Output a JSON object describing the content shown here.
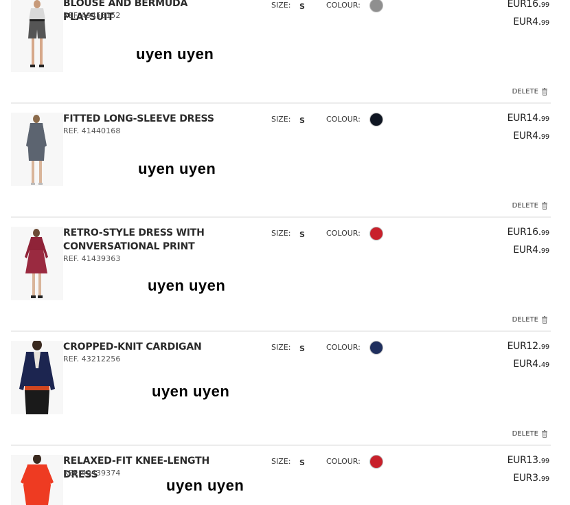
{
  "labels": {
    "size": "SIZE:",
    "colour": "COLOUR:",
    "delete": "DELETE"
  },
  "items": [
    {
      "name": "BLOUSE AND BERMUDA PLAYSUIT",
      "ref": "REF. 49453152",
      "size": "S",
      "colour_hex": "#8f8f8f",
      "price_main": "EUR16.",
      "price_cents": "99",
      "price2_main": "EUR4.",
      "price2_cents": "99",
      "note": "uyen uyen",
      "thumb_icon": "playsuit-photo"
    },
    {
      "name": "FITTED LONG-SLEEVE DRESS",
      "ref": "REF. 41440168",
      "size": "S",
      "colour_hex": "#0f1622",
      "price_main": "EUR14.",
      "price_cents": "99",
      "price2_main": "EUR4.",
      "price2_cents": "99",
      "note": "uyen uyen",
      "thumb_icon": "grey-dress-photo"
    },
    {
      "name": "RETRO-STYLE DRESS WITH CONVERSATIONAL PRINT",
      "ref": "REF. 41439363",
      "size": "S",
      "colour_hex": "#c8202b",
      "price_main": "EUR16.",
      "price_cents": "99",
      "price2_main": "EUR4.",
      "price2_cents": "99",
      "note": "uyen uyen",
      "thumb_icon": "red-dress-photo"
    },
    {
      "name": "CROPPED-KNIT CARDIGAN",
      "ref": "REF. 43212256",
      "size": "S",
      "colour_hex": "#1f2f5e",
      "price_main": "EUR12.",
      "price_cents": "99",
      "price2_main": "EUR4.",
      "price2_cents": "49",
      "note": "uyen uyen",
      "thumb_icon": "cardigan-photo"
    },
    {
      "name": "RELAXED-FIT KNEE-LENGTH DRESS",
      "ref": "REF. 49439374",
      "size": "S",
      "colour_hex": "#c8202b",
      "price_main": "EUR13.",
      "price_cents": "99",
      "price2_main": "EUR3.",
      "price2_cents": "99",
      "note": "uyen uyen",
      "thumb_icon": "orange-dress-photo"
    }
  ]
}
